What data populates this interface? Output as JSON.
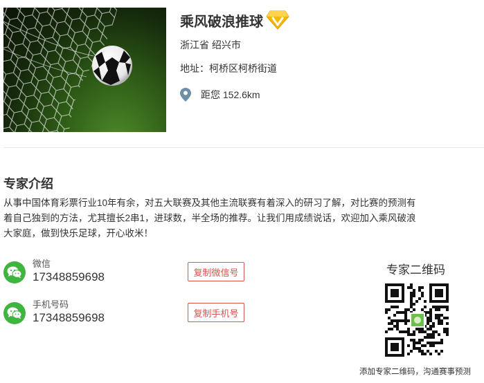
{
  "header": {
    "title": "乘风破浪推球",
    "region": "浙江省 绍兴市",
    "address": "地址：柯桥区柯桥街道",
    "distance": "距您 152.6km"
  },
  "intro": {
    "heading": "专家介绍",
    "body": "从事中国体育彩票行业10年有余，对五大联赛及其他主流联赛有着深入的研习了解，对比赛的预测有着自己独到的方法，尤其擅长2串1，进球数，半全场的推荐。让我们用成绩说话，欢迎加入乘风破浪大家庭，做到快乐足球，开心收米！"
  },
  "contacts": {
    "wechat": {
      "label": "微信",
      "value": "17348859698",
      "button": "复制微信号"
    },
    "phone": {
      "label": "手机号码",
      "value": "17348859698",
      "button": "复制手机号"
    }
  },
  "qr": {
    "title": "专家二维码",
    "caption": "添加专家二维码，沟通赛事预测"
  },
  "colors": {
    "accent_red": "#d9534f",
    "wechat_green": "#3fb441",
    "vip_gold": "#f5b700"
  },
  "icons": {
    "hero": "soccer-ball-in-net-image",
    "vip": "vip-diamond-icon",
    "location": "location-pin-icon",
    "wechat": "wechat-icon",
    "qr": "qr-code-image"
  }
}
